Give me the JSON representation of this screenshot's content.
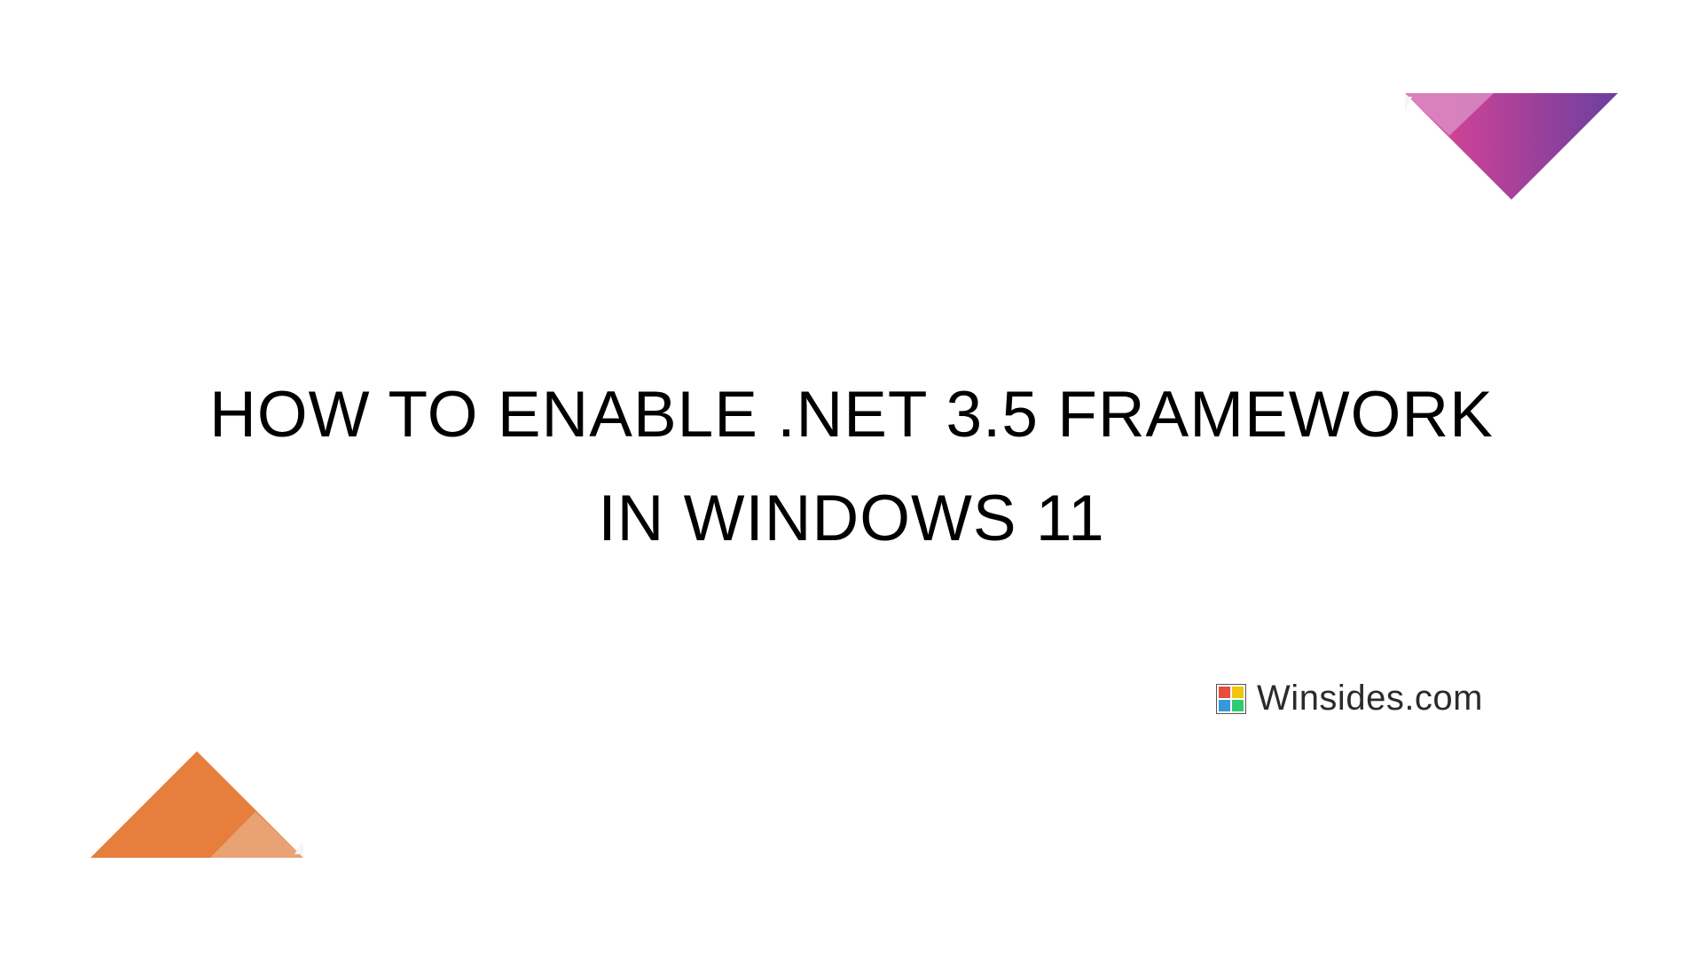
{
  "title": {
    "line1": "HOW TO ENABLE .NET 3.5 FRAMEWORK",
    "line2": "IN WINDOWS 11"
  },
  "brand": {
    "text": "Winsides.com",
    "logo_colors": {
      "top_left": "#e74c3c",
      "top_right": "#f1c40f",
      "bottom_left": "#3498db",
      "bottom_right": "#2ecc71"
    }
  },
  "decorations": {
    "top_triangle": {
      "gradient_start": "#e94393",
      "gradient_end": "#6b3fa0",
      "inner_color": "#d88cc4"
    },
    "bottom_triangle": {
      "main_color": "#e67e3c",
      "inner_color": "#e8a679"
    }
  }
}
